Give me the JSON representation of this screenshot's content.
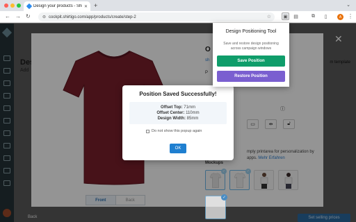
{
  "browser": {
    "tab_title": "Design your products - Shirt",
    "url": "cockpit.shirtigo.com/app/products/create/step-2",
    "profile_initial": "A"
  },
  "background_page": {
    "heading_fragment": "Des",
    "sub_fragment": "Add",
    "template_fragment": "m template",
    "back_label": "Back",
    "cta_label": "Set selling prices"
  },
  "product_panel": {
    "title_fragment": "O",
    "view_toggle": [
      "Front",
      "Back"
    ],
    "text_line1": "mply printarea for personalization by",
    "text_line2": "apps.",
    "text_link": "Mehr Erfahren",
    "mockups_label": "Mockups",
    "shirt_color": "#7a1f2b"
  },
  "success_popup": {
    "title": "Position Saved Successfully!",
    "offset_top_label": "Offset Top:",
    "offset_top_value": "71mm",
    "offset_center_label": "Offset Center:",
    "offset_center_value": "110mm",
    "design_width_label": "Design Width:",
    "design_width_value": "85mm",
    "checkbox_label": "Do not show this popup again",
    "ok_label": "OK"
  },
  "extension_popup": {
    "title": "Design Positioning Tool",
    "description": "Save and restore design positioning across campaign windows",
    "save_label": "Save Position",
    "restore_label": "Restore Position"
  },
  "colors": {
    "save": "#0f9d6a",
    "restore": "#7a5fd0",
    "ok": "#1f7fd0"
  }
}
